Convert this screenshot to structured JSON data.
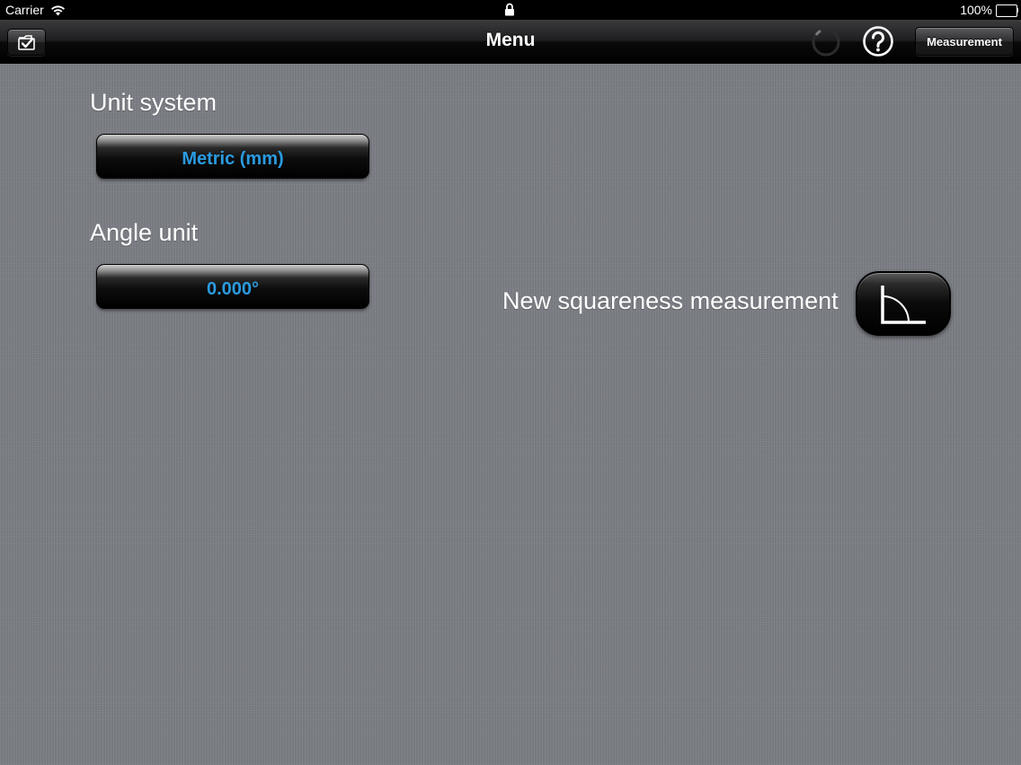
{
  "status_bar": {
    "carrier": "Carrier",
    "battery": "100%"
  },
  "nav": {
    "title": "Menu",
    "measurement_label": "Measurement"
  },
  "settings": {
    "unit_system_label": "Unit system",
    "unit_system_value": "Metric (mm)",
    "angle_unit_label": "Angle unit",
    "angle_unit_value": "0.000°"
  },
  "actions": {
    "new_squareness_label": "New squareness measurement"
  },
  "colors": {
    "value_text": "#2a9be0",
    "background": "#7b7e85"
  },
  "icons": {
    "folder": "folder-check-icon",
    "spinner": "activity-spinner-icon",
    "help": "help-icon",
    "squareness": "right-angle-icon"
  }
}
